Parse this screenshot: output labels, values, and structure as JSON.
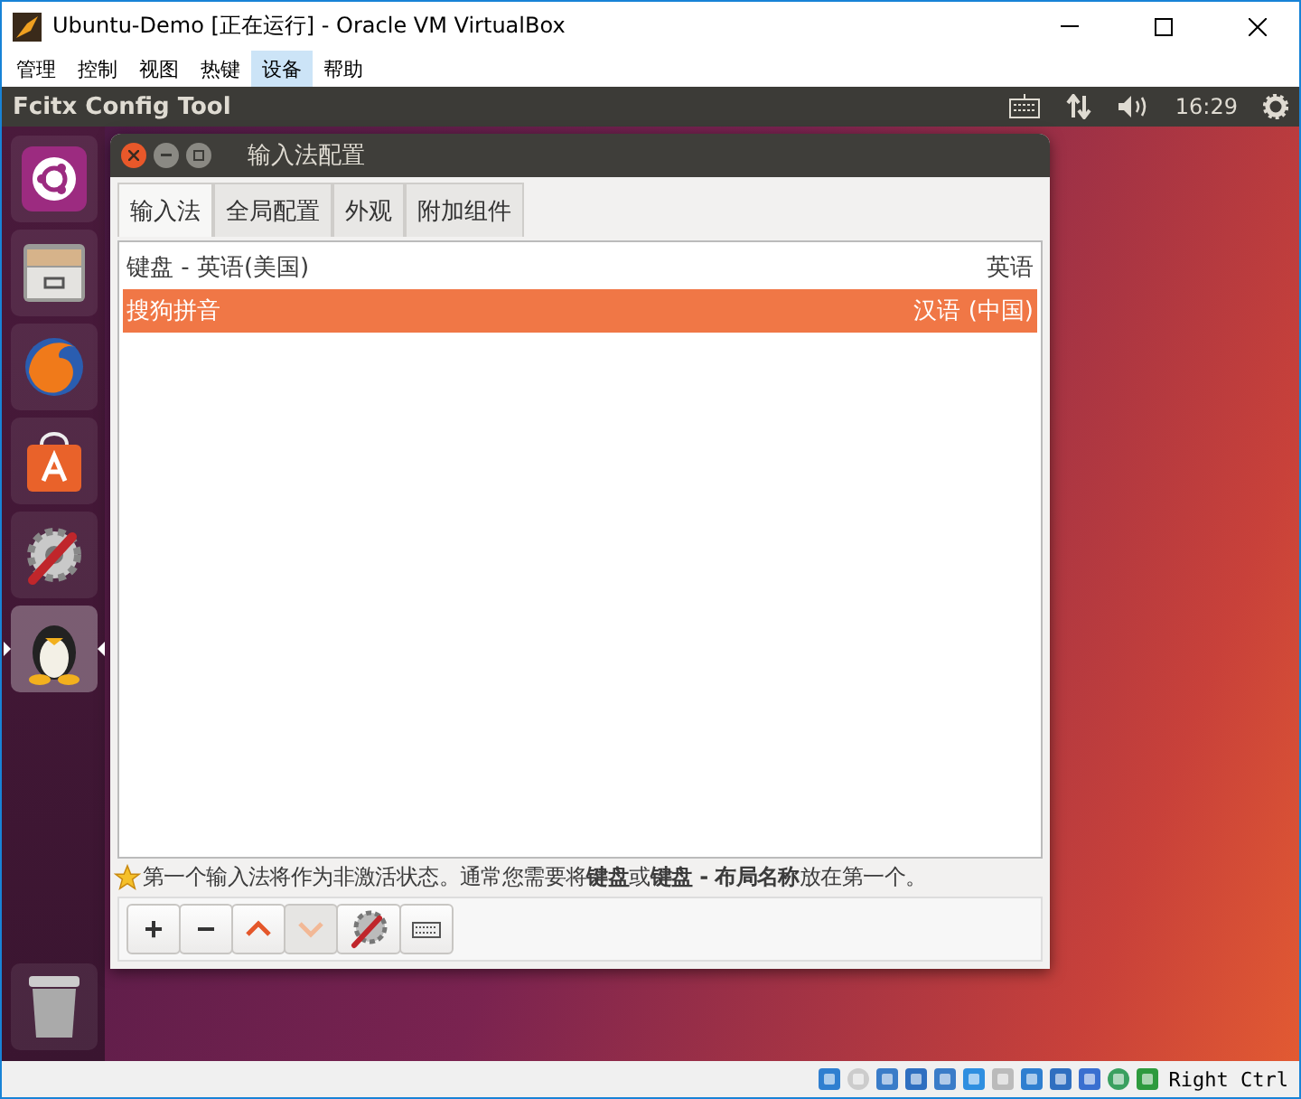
{
  "window": {
    "title": "Ubuntu-Demo [正在运行] - Oracle VM VirtualBox"
  },
  "menu": [
    {
      "label": "管理",
      "selected": false
    },
    {
      "label": "控制",
      "selected": false
    },
    {
      "label": "视图",
      "selected": false
    },
    {
      "label": "热键",
      "selected": false
    },
    {
      "label": "设备",
      "selected": true
    },
    {
      "label": "帮助",
      "selected": false
    }
  ],
  "top_panel": {
    "app_title": "Fcitx Config Tool",
    "time": "16:29"
  },
  "launcher": [
    {
      "kind": "ubuntu",
      "selected": false
    },
    {
      "kind": "files",
      "selected": false
    },
    {
      "kind": "browser",
      "selected": false
    },
    {
      "kind": "store",
      "selected": false
    },
    {
      "kind": "settings",
      "selected": false
    },
    {
      "kind": "penguin",
      "selected": true
    }
  ],
  "dialog": {
    "title": "输入法配置",
    "tabs": [
      {
        "label": "输入法",
        "selected": true
      },
      {
        "label": "全局配置",
        "selected": false
      },
      {
        "label": "外观",
        "selected": false
      },
      {
        "label": "附加组件",
        "selected": false
      }
    ],
    "rows": [
      {
        "name": "键盘 - 英语(美国)",
        "language": "英语",
        "selected": false
      },
      {
        "name": "搜狗拼音",
        "language": "汉语 (中国)",
        "selected": true
      }
    ],
    "hint": "第一个输入法将作为非激活状态。通常您需要将**键盘**或**键盘 - 布局名称**放在第一个。",
    "toolbar": [
      {
        "kind": "add",
        "label": "+",
        "disabled": false
      },
      {
        "kind": "remove",
        "label": "−",
        "disabled": false
      },
      {
        "kind": "up",
        "disabled": false
      },
      {
        "kind": "down",
        "disabled": true
      },
      {
        "kind": "configure",
        "disabled": false
      },
      {
        "kind": "keyboard",
        "disabled": false
      }
    ]
  },
  "status_bar": {
    "host_key": "Right Ctrl"
  }
}
